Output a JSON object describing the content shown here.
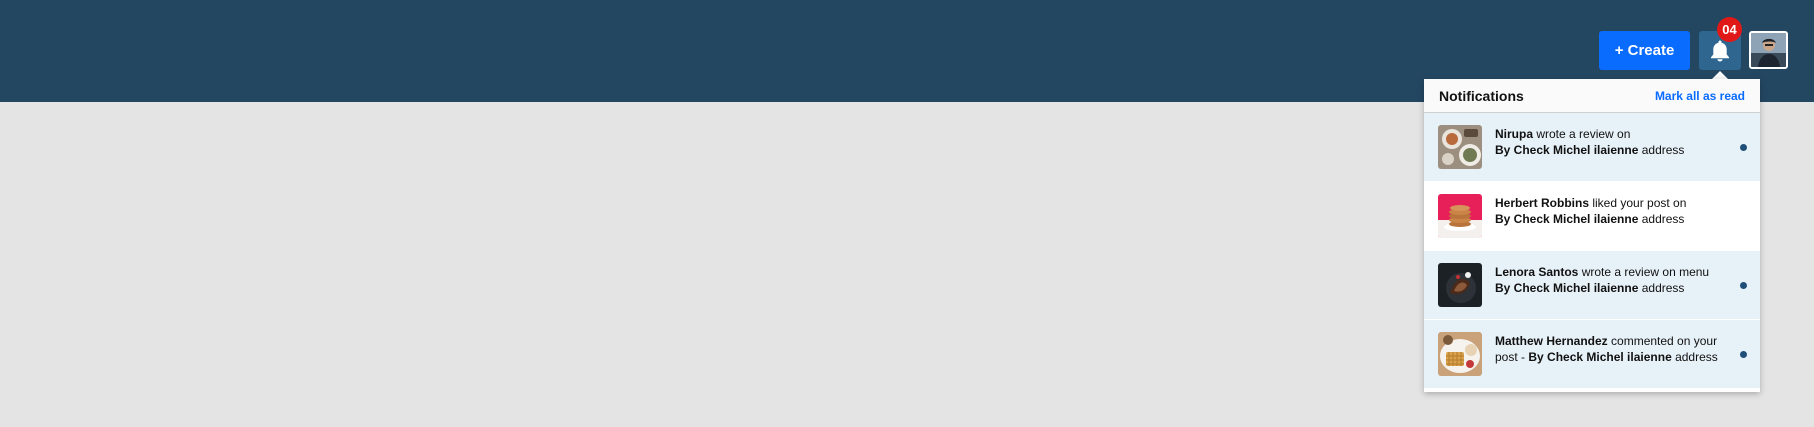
{
  "header": {
    "create_label": "+ Create",
    "notification_count": "04",
    "colors": {
      "topbar": "#244761",
      "create_button": "#0a6cff",
      "badge": "#e01818"
    }
  },
  "notifications_panel": {
    "title": "Notifications",
    "mark_all_label": "Mark all as read",
    "items": [
      {
        "actor": "Nirupa",
        "action": " wrote a review on",
        "prefix": "",
        "target": "By Check Michel ilaienne",
        "suffix": " address",
        "unread": true,
        "thumb_icon": "food-plate-icon"
      },
      {
        "actor": "Herbert Robbins",
        "action": " liked your post on",
        "prefix": "",
        "target": "By Check Michel ilaienne",
        "suffix": " address",
        "unread": false,
        "thumb_icon": "cookie-stack-icon"
      },
      {
        "actor": "Lenora Santos",
        "action": " wrote a review on menu",
        "prefix": "",
        "target": "By Check Michel ilaienne",
        "suffix": " address",
        "unread": true,
        "thumb_icon": "chocolate-dessert-icon"
      },
      {
        "actor": "Matthew Hernandez",
        "action": " commented on your post",
        "prefix": " - ",
        "target": "By Check Michel ilaienne",
        "suffix": " address",
        "unread": true,
        "thumb_icon": "waffle-plate-icon"
      }
    ]
  }
}
